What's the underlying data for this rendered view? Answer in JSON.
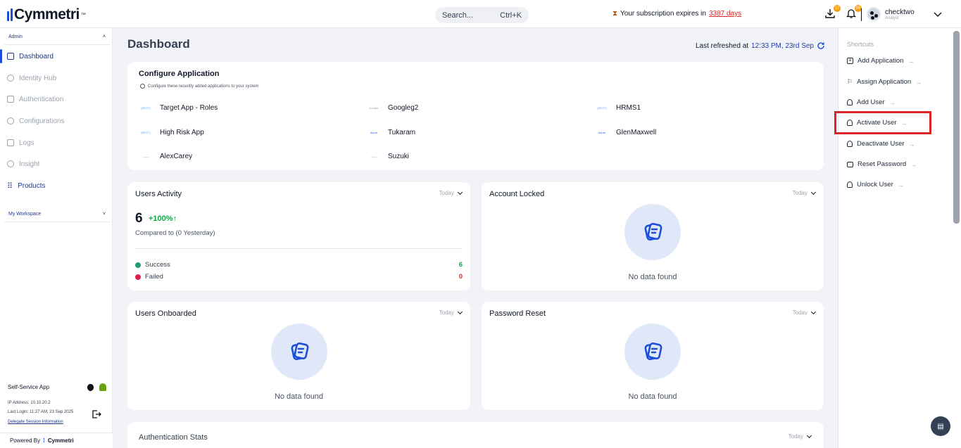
{
  "brand": {
    "logo_text": "Cymmetri",
    "tm": "™"
  },
  "topbar": {
    "search_placeholder": "Search...",
    "search_shortcut": "Ctrl+K",
    "subscription_text": "Your subscription expires in",
    "subscription_days": "3387 days",
    "download_badge": "10",
    "notification_badge": "99",
    "user_name": "checktwo",
    "user_role": "Analyst"
  },
  "sidebar": {
    "admin_label": "Admin",
    "items": [
      {
        "label": "Dashboard",
        "icon": "dashboard-icon"
      },
      {
        "label": "Identity Hub",
        "icon": "users-icon"
      },
      {
        "label": "Authentication",
        "icon": "key-icon"
      },
      {
        "label": "Configurations",
        "icon": "gear-icon"
      },
      {
        "label": "Logs",
        "icon": "logs-icon"
      },
      {
        "label": "Insight",
        "icon": "insight-icon"
      },
      {
        "label": "Products",
        "icon": "grid-icon"
      }
    ],
    "workspace_label": "My Workspace",
    "self_service_label": "Self-Service App",
    "ip_label": "IP Address:",
    "ip_value": "10.10.20.2",
    "last_login_label": "Last Login:",
    "last_login_value": "11:27 AM, 23 Sep 2025",
    "delegate_link": "Delegate Session Information",
    "powered_by": "Powered By"
  },
  "main": {
    "title": "Dashboard",
    "refresh_label": "Last refreshed at",
    "refresh_time": "12:33 PM, 23rd Sep",
    "configure": {
      "title": "Configure Application",
      "subtitle": "Configure these recently added applications to your system",
      "apps": [
        {
          "name": "Target App - Roles",
          "logo": "{REST}"
        },
        {
          "name": "Googleg2",
          "logo": "Google"
        },
        {
          "name": "HRMS1",
          "logo": "{REST}"
        },
        {
          "name": "High Risk App",
          "logo": "{REST}"
        },
        {
          "name": "Tukaram",
          "logo": "Azure"
        },
        {
          "name": "GlenMaxwell",
          "logo": "Azure"
        },
        {
          "name": "AlexCarey",
          "logo": "——"
        },
        {
          "name": "Suzuki",
          "logo": "——"
        }
      ]
    },
    "users_activity": {
      "title": "Users Activity",
      "period": "Today",
      "count": "6",
      "change": "+100%",
      "compare": "Compared to (0 Yesterday)",
      "success_label": "Success",
      "success_value": "6",
      "failed_label": "Failed",
      "failed_value": "0"
    },
    "account_locked": {
      "title": "Account Locked",
      "period": "Today",
      "empty": "No data found"
    },
    "users_onboarded": {
      "title": "Users Onboarded",
      "period": "Today",
      "empty": "No data found"
    },
    "password_reset": {
      "title": "Password Reset",
      "period": "Today",
      "empty": "No data found"
    },
    "auth_stats": {
      "title": "Authentication Stats",
      "period": "Today"
    }
  },
  "shortcuts": {
    "title": "Shortcuts",
    "items": [
      {
        "label": "Add Application",
        "icon": "plus-square-icon"
      },
      {
        "label": "Assign Application",
        "icon": "flag-icon"
      },
      {
        "label": "Add User",
        "icon": "user-icon"
      },
      {
        "label": "Activate User",
        "icon": "user-icon"
      },
      {
        "label": "Deactivate User",
        "icon": "user-icon"
      },
      {
        "label": "Reset Password",
        "icon": "password-icon"
      },
      {
        "label": "Unlock User",
        "icon": "user-icon"
      }
    ]
  },
  "colors": {
    "accent": "#1d4ed8",
    "success": "#16a34a",
    "danger": "#dc2626",
    "highlight": "#dc2626"
  }
}
